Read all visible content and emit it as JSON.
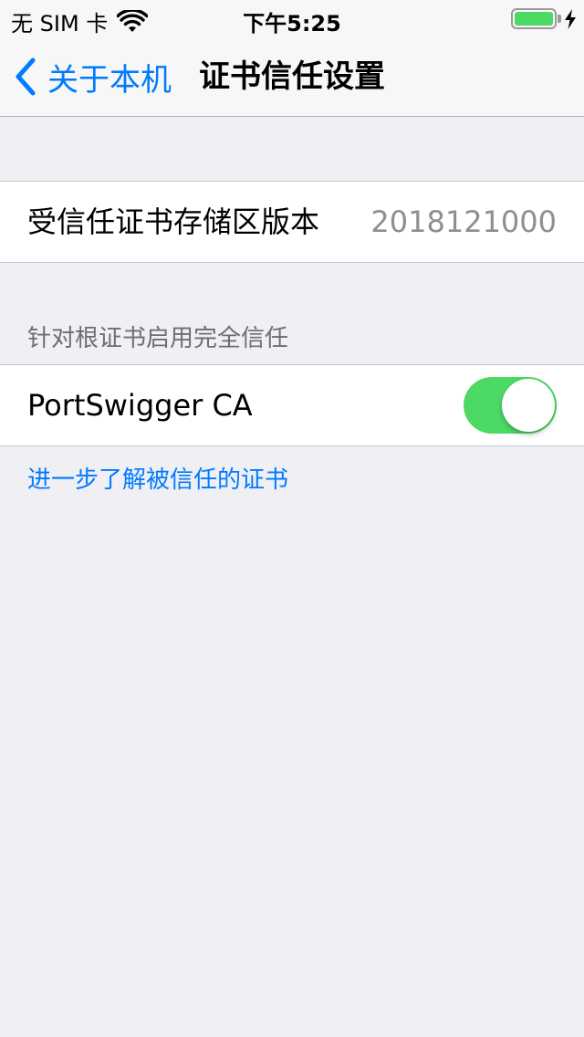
{
  "status_bar": {
    "carrier": "无 SIM 卡",
    "time": "下午5:25",
    "battery_level": 1.0,
    "charging": true
  },
  "nav": {
    "back_label": "关于本机",
    "title": "证书信任设置"
  },
  "trust_store": {
    "label": "受信任证书存储区版本",
    "value": "2018121000"
  },
  "root_trust": {
    "section_header": "针对根证书启用完全信任",
    "certificates": [
      {
        "name": "PortSwigger CA",
        "enabled": true
      }
    ]
  },
  "footer_link": "进一步了解被信任的证书",
  "colors": {
    "accent": "#007aff",
    "toggle_on": "#4cd964",
    "background": "#efeff4"
  }
}
